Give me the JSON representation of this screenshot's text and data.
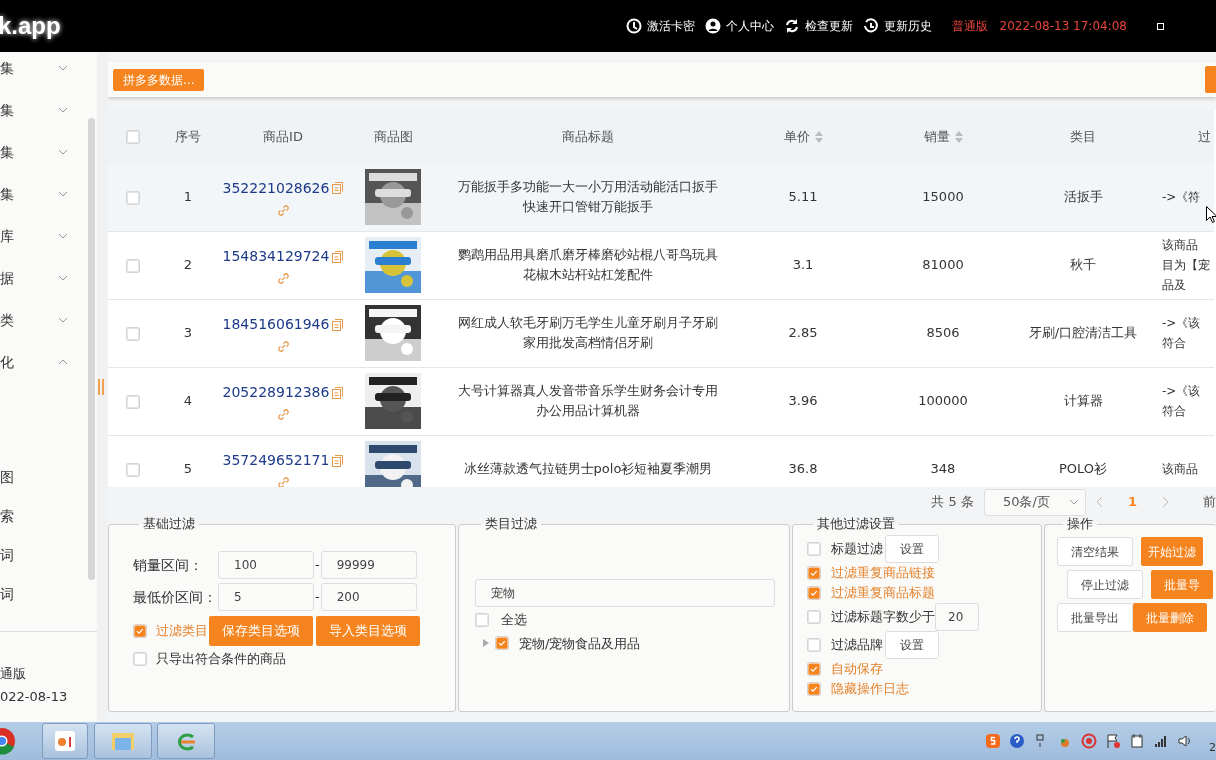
{
  "app": {
    "logo": "k.app",
    "nav": [
      {
        "label": "激活卡密"
      },
      {
        "label": "个人中心"
      },
      {
        "label": "检查更新"
      },
      {
        "label": "更新历史"
      }
    ],
    "edition": "普通版",
    "datetime": "2022-08-13 17:04:08"
  },
  "sidebar": {
    "items": [
      {
        "label": "集",
        "expanded": false
      },
      {
        "label": "集",
        "expanded": false
      },
      {
        "label": "集",
        "expanded": false
      },
      {
        "label": "集",
        "expanded": false
      },
      {
        "label": "库",
        "expanded": false
      },
      {
        "label": "据",
        "expanded": false
      },
      {
        "label": "类",
        "expanded": false
      },
      {
        "label": "化",
        "expanded": true,
        "children": [
          {
            "label": "图"
          },
          {
            "label": "索"
          },
          {
            "label": "词"
          },
          {
            "label": "词"
          }
        ]
      }
    ],
    "footer": [
      "通版",
      "022-08-13"
    ]
  },
  "toolbar": {
    "button": "拼多多数据..."
  },
  "table": {
    "checked": false,
    "columns": [
      {
        "label": "序号",
        "sortable": false
      },
      {
        "label": "商品ID",
        "sortable": false
      },
      {
        "label": "商品图",
        "sortable": false
      },
      {
        "label": "商品标题",
        "sortable": false
      },
      {
        "label": "单价",
        "sortable": true
      },
      {
        "label": "销量",
        "sortable": true
      },
      {
        "label": "类目",
        "sortable": false
      },
      {
        "label": "过"
      }
    ],
    "rows": [
      {
        "checked": false,
        "hovered": true,
        "index": "1",
        "id": "352221028626",
        "title": [
          "万能扳手多功能一大一小万用活动能活口扳手",
          "快速开口管钳万能扳手"
        ],
        "price": "5.11",
        "sales": "15000",
        "category": "活扳手",
        "filter": [
          "->《符"
        ]
      },
      {
        "checked": false,
        "hovered": false,
        "index": "2",
        "id": "154834129724",
        "title": [
          "鹦鹉用品用具磨爪磨牙棒磨砂站棍八哥鸟玩具",
          "花椒木站杆站杠笼配件"
        ],
        "price": "3.1",
        "sales": "81000",
        "category": "秋千",
        "filter": [
          "该商品",
          "目为【宠",
          "品及"
        ]
      },
      {
        "checked": false,
        "hovered": false,
        "index": "3",
        "id": "184516061946",
        "title": [
          "网红成人软毛牙刷万毛学生儿童牙刷月子牙刷",
          "家用批发高档情侣牙刷"
        ],
        "price": "2.85",
        "sales": "8506",
        "category": "牙刷/口腔清洁工具",
        "filter": [
          "->《该",
          "符合"
        ]
      },
      {
        "checked": false,
        "hovered": false,
        "index": "4",
        "id": "205228912386",
        "title": [
          "大号计算器真人发音带音乐学生财务会计专用",
          "办公用品计算机器"
        ],
        "price": "3.96",
        "sales": "100000",
        "category": "计算器",
        "filter": [
          "->《该",
          "符合"
        ]
      },
      {
        "checked": false,
        "hovered": false,
        "index": "5",
        "id": "357249652171",
        "title": [
          "冰丝薄款透气拉链男士polo衫短袖夏季潮男"
        ],
        "price": "36.8",
        "sales": "348",
        "category": "POLO衫",
        "filter": [
          "该商品"
        ]
      }
    ]
  },
  "pagination": {
    "total": "共 5 条",
    "page_size": "50条/页",
    "pages": [
      {
        "label": "1",
        "selected": true
      }
    ],
    "goto": "前"
  },
  "basic_filter": {
    "legend": "基础过滤",
    "ranges": [
      {
        "label": "销量区间：",
        "min": "100",
        "separator": "-",
        "max": "99999"
      },
      {
        "label": "最低价区间：",
        "min": "5",
        "separator": "-",
        "max": "200"
      }
    ],
    "options": [
      {
        "label": "过滤类目",
        "checked": true
      },
      {
        "label": "只导出符合条件的商品",
        "checked": false
      }
    ],
    "buttons": [
      "保存类目选项",
      "导入类目选项"
    ]
  },
  "category_filter": {
    "legend": "类目过滤",
    "search": "宠物",
    "select_all": {
      "label": "全选",
      "checked": false
    },
    "tree": [
      {
        "label": "宠物/宠物食品及用品",
        "checked": true,
        "expanded": false
      }
    ]
  },
  "other_filter": {
    "legend": "其他过滤设置",
    "options": [
      {
        "kind": "button",
        "label": "标题过滤",
        "checked": false,
        "button": "设置"
      },
      {
        "kind": "plain",
        "label": "过滤重复商品链接",
        "checked": true
      },
      {
        "kind": "plain",
        "label": "过滤重复商品标题",
        "checked": true
      },
      {
        "kind": "input",
        "label": "过滤标题字数少于",
        "checked": false,
        "value": "20"
      },
      {
        "kind": "button",
        "label": "过滤品牌",
        "checked": false,
        "button": "设置"
      },
      {
        "kind": "plain",
        "label": "自动保存",
        "checked": true
      },
      {
        "kind": "plain",
        "label": "隐藏操作日志",
        "checked": true
      }
    ]
  },
  "operations": {
    "legend": "操作",
    "rows": [
      [
        {
          "label": "清空结果",
          "primary": false
        },
        {
          "label": "开始过滤",
          "primary": true
        }
      ],
      [
        {
          "label": "停止过滤",
          "primary": false
        },
        {
          "label": "批量导",
          "primary": true
        }
      ],
      [
        {
          "label": "批量导出",
          "primary": false
        },
        {
          "label": "批量删除",
          "primary": true
        }
      ]
    ]
  },
  "taskbar": {
    "clock": "2"
  }
}
